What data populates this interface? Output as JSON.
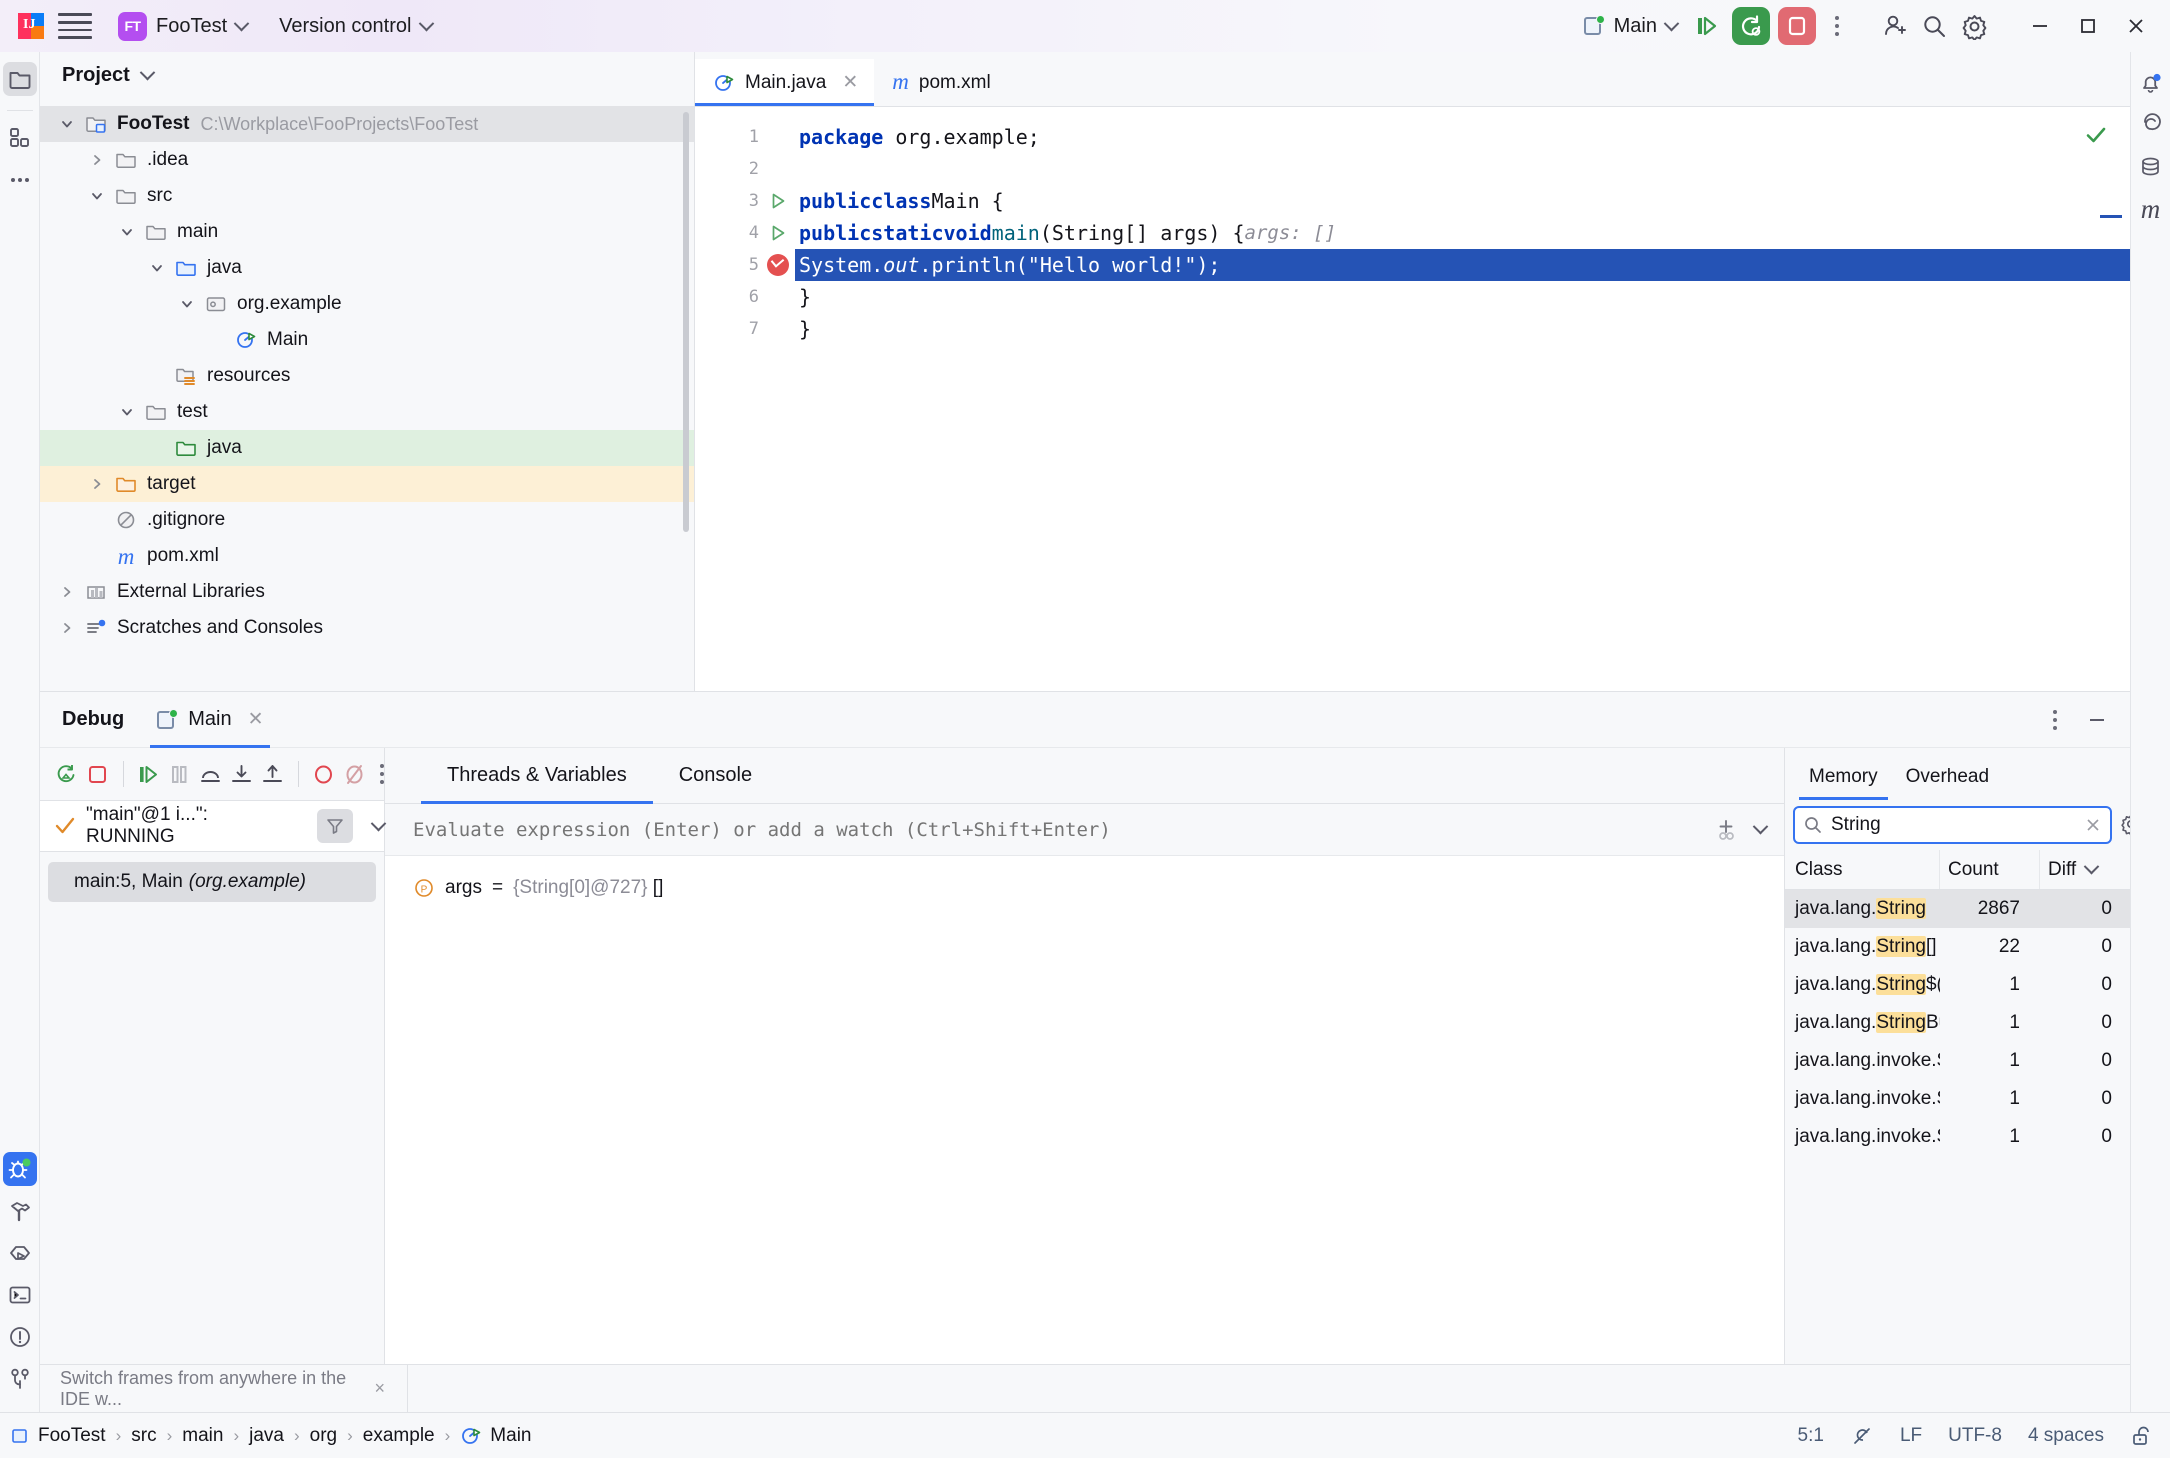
{
  "titlebar": {
    "menu_icon": "hamburger-icon",
    "project_badge": "FT",
    "project_name": "FooTest",
    "version_control": "Version control",
    "run_config": "Main",
    "debug_icon": "debug-icon",
    "stop_icon": "stop-icon",
    "more_icon": "more-actions-icon",
    "add_user_icon": "add-user-icon",
    "search_icon": "search-icon",
    "settings_icon": "gear-icon",
    "minimize": "minimize-icon",
    "maximize": "maximize-icon",
    "close": "close-icon",
    "accent_purple": "#b44ef0",
    "accent_blue": "#3573f0",
    "run_green": "#3a9a4d",
    "stop_red": "#e16a72"
  },
  "left_strip": {
    "items": [
      {
        "name": "project-tool-window",
        "icon": "folder-icon",
        "selected": true
      },
      {
        "name": "structure-tool-window",
        "icon": "modules-icon",
        "selected": false
      },
      {
        "name": "more-tool-windows",
        "icon": "ellipsis-icon",
        "selected": false
      }
    ],
    "bottom_items": [
      {
        "name": "debug-tool-window",
        "icon": "bug-icon",
        "selected": true
      },
      {
        "name": "build-tool-window",
        "icon": "hammer-icon",
        "selected": false
      },
      {
        "name": "run-tool-window",
        "icon": "run-icon",
        "selected": false
      },
      {
        "name": "terminal-tool-window",
        "icon": "terminal-icon",
        "selected": false
      },
      {
        "name": "problems-tool-window",
        "icon": "warning-icon",
        "selected": false
      },
      {
        "name": "version-control-tool-window",
        "icon": "branch-icon",
        "selected": false
      }
    ]
  },
  "right_strip": {
    "items": [
      {
        "name": "notifications",
        "icon": "bell-icon"
      },
      {
        "name": "ai-assistant",
        "icon": "spiral-icon"
      },
      {
        "name": "database",
        "icon": "database-icon"
      },
      {
        "name": "maven",
        "icon": "maven-m-icon"
      }
    ]
  },
  "project": {
    "title": "Project",
    "tree": [
      {
        "label": "FooTest",
        "path": "C:\\Workplace\\FooProjects\\FooTest",
        "depth": 0,
        "twist": "down",
        "icon": "project-folder-icon",
        "state": "sel-grey",
        "bold": true
      },
      {
        "label": ".idea",
        "path": "",
        "depth": 1,
        "twist": "right",
        "icon": "folder-icon",
        "state": "",
        "bold": false
      },
      {
        "label": "src",
        "path": "",
        "depth": 1,
        "twist": "down",
        "icon": "folder-icon",
        "state": "",
        "bold": false
      },
      {
        "label": "main",
        "path": "",
        "depth": 2,
        "twist": "down",
        "icon": "folder-icon",
        "state": "",
        "bold": false
      },
      {
        "label": "java",
        "path": "",
        "depth": 3,
        "twist": "down",
        "icon": "source-folder-icon",
        "state": "",
        "bold": false
      },
      {
        "label": "org.example",
        "path": "",
        "depth": 4,
        "twist": "down",
        "icon": "package-icon",
        "state": "",
        "bold": false
      },
      {
        "label": "Main",
        "path": "",
        "depth": 5,
        "twist": "none",
        "icon": "java-class-runnable-icon",
        "state": "",
        "bold": false
      },
      {
        "label": "resources",
        "path": "",
        "depth": 3,
        "twist": "none",
        "icon": "resources-folder-icon",
        "state": "",
        "bold": false
      },
      {
        "label": "test",
        "path": "",
        "depth": 2,
        "twist": "down",
        "icon": "folder-icon",
        "state": "",
        "bold": false
      },
      {
        "label": "java",
        "path": "",
        "depth": 3,
        "twist": "none",
        "icon": "test-source-folder-icon",
        "state": "sel-green",
        "bold": false
      },
      {
        "label": "target",
        "path": "",
        "depth": 1,
        "twist": "right",
        "icon": "excluded-folder-icon",
        "state": "sel-amber",
        "bold": false
      },
      {
        "label": ".gitignore",
        "path": "",
        "depth": 1,
        "twist": "none",
        "icon": "gitignore-icon",
        "state": "",
        "bold": false
      },
      {
        "label": "pom.xml",
        "path": "",
        "depth": 1,
        "twist": "none",
        "icon": "maven-m-icon",
        "state": "",
        "bold": false
      },
      {
        "label": "External Libraries",
        "path": "",
        "depth": 0,
        "twist": "right",
        "icon": "libraries-icon",
        "state": "",
        "bold": false
      },
      {
        "label": "Scratches and Consoles",
        "path": "",
        "depth": 0,
        "twist": "right",
        "icon": "scratches-icon",
        "state": "",
        "bold": false
      }
    ]
  },
  "editor": {
    "tabs": [
      {
        "label": "Main.java",
        "icon": "java-class-runnable-icon",
        "active": true,
        "closable": true
      },
      {
        "label": "pom.xml",
        "icon": "maven-m-icon",
        "active": false,
        "closable": false
      }
    ],
    "lines": [
      {
        "num": "1",
        "marker": "none",
        "highlight": false
      },
      {
        "num": "2",
        "marker": "none",
        "highlight": false
      },
      {
        "num": "3",
        "marker": "run",
        "highlight": false
      },
      {
        "num": "4",
        "marker": "run",
        "highlight": false
      },
      {
        "num": "5",
        "marker": "breakpoint",
        "highlight": true
      },
      {
        "num": "6",
        "marker": "none",
        "highlight": false
      },
      {
        "num": "7",
        "marker": "none",
        "highlight": false
      }
    ],
    "code": {
      "l1_kw": "package",
      "l1_rest": " org.example;",
      "l3_kw1": "public",
      "l3_kw2": "class",
      "l3_name": "Main {",
      "l4_kw1": "public",
      "l4_kw2": "static",
      "l4_kw3": "void",
      "l4_fn": "main",
      "l4_args": "(String[] args) {",
      "l4_hint": "args: []",
      "l5_obj": "System.",
      "l5_field": "out",
      "l5_call": ".println(",
      "l5_str": "\"Hello world!\"",
      "l5_end": ");",
      "l6": "}",
      "l7": "}"
    },
    "inspection_status": "no-problems-icon"
  },
  "debug": {
    "window_title": "Debug",
    "session_tab": "Main",
    "toolbar": [
      {
        "name": "rerun-button",
        "icon": "rerun-debug-icon"
      },
      {
        "name": "stop-button",
        "icon": "stop-icon"
      },
      {
        "name": "resume-button",
        "icon": "resume-program-icon"
      },
      {
        "name": "pause-button",
        "icon": "pause-program-icon"
      },
      {
        "name": "step-over-button",
        "icon": "step-over-icon"
      },
      {
        "name": "step-into-button",
        "icon": "step-into-icon"
      },
      {
        "name": "step-out-button",
        "icon": "step-out-icon"
      },
      {
        "name": "view-breakpoints-button",
        "icon": "breakpoints-icon"
      },
      {
        "name": "mute-breakpoints-button",
        "icon": "mute-breakpoints-icon"
      },
      {
        "name": "more-button",
        "icon": "more-actions-icon"
      }
    ],
    "thread": {
      "label": "\"main\"@1 i...\": RUNNING",
      "status_icon": "check-icon",
      "filter_icon": "filter-icon",
      "dropdown_icon": "chevron-down-icon"
    },
    "frames": [
      {
        "label": "main:5, Main",
        "package": "(org.example)",
        "selected": true
      }
    ],
    "tabs": [
      {
        "label": "Threads & Variables",
        "active": true
      },
      {
        "label": "Console",
        "active": false
      }
    ],
    "evaluate_placeholder": "Evaluate expression (Enter) or add a watch (Ctrl+Shift+Enter)",
    "add_watch_icon": "add-watch-icon",
    "watch_chevron_icon": "chevron-down-icon",
    "layout_settings_icon": "layout-settings-icon",
    "variables": [
      {
        "badge": "P",
        "name": "args",
        "eq": "=",
        "value": "{String[0]@727}",
        "suffix": "[]"
      }
    ],
    "hint_text": "Switch frames from anywhere in the IDE w...",
    "hint_close": "×"
  },
  "memory": {
    "tabs": [
      {
        "label": "Memory",
        "active": true
      },
      {
        "label": "Overhead",
        "active": false
      }
    ],
    "search_value": "String",
    "search_icon": "search-icon",
    "clear_icon": "close-icon",
    "settings_icon": "gear-icon",
    "columns": [
      "Class",
      "Count",
      "Diff"
    ],
    "sort_icon": "chevron-down-icon",
    "rows": [
      {
        "class_prefix": "java.lang.",
        "class_match": "String",
        "class_suffix": "",
        "count": "2867",
        "diff": "0",
        "selected": true
      },
      {
        "class_prefix": "java.lang.",
        "class_match": "String",
        "class_suffix": "[]",
        "count": "22",
        "diff": "0",
        "selected": false
      },
      {
        "class_prefix": "java.lang.",
        "class_match": "String",
        "class_suffix": "$(",
        "count": "1",
        "diff": "0",
        "selected": false
      },
      {
        "class_prefix": "java.lang.",
        "class_match": "String",
        "class_suffix": "Bu",
        "count": "1",
        "diff": "0",
        "selected": false
      },
      {
        "class_prefix": "java.lang.invoke.S",
        "class_match": "",
        "class_suffix": "",
        "count": "1",
        "diff": "0",
        "selected": false
      },
      {
        "class_prefix": "java.lang.invoke.S",
        "class_match": "",
        "class_suffix": "",
        "count": "1",
        "diff": "0",
        "selected": false
      },
      {
        "class_prefix": "java.lang.invoke.S",
        "class_match": "",
        "class_suffix": "",
        "count": "1",
        "diff": "0",
        "selected": false
      }
    ]
  },
  "statusbar": {
    "breadcrumbs": [
      {
        "label": "FooTest",
        "icon": "module-icon"
      },
      {
        "label": "src",
        "icon": ""
      },
      {
        "label": "main",
        "icon": ""
      },
      {
        "label": "java",
        "icon": ""
      },
      {
        "label": "org",
        "icon": ""
      },
      {
        "label": "example",
        "icon": ""
      },
      {
        "label": "Main",
        "icon": "java-class-runnable-icon"
      }
    ],
    "separator": "›",
    "caret_position": "5:1",
    "inspections_icon": "inspections-off-icon",
    "line_separator": "LF",
    "encoding": "UTF-8",
    "indent": "4 spaces",
    "lock_icon": "unlock-icon"
  }
}
